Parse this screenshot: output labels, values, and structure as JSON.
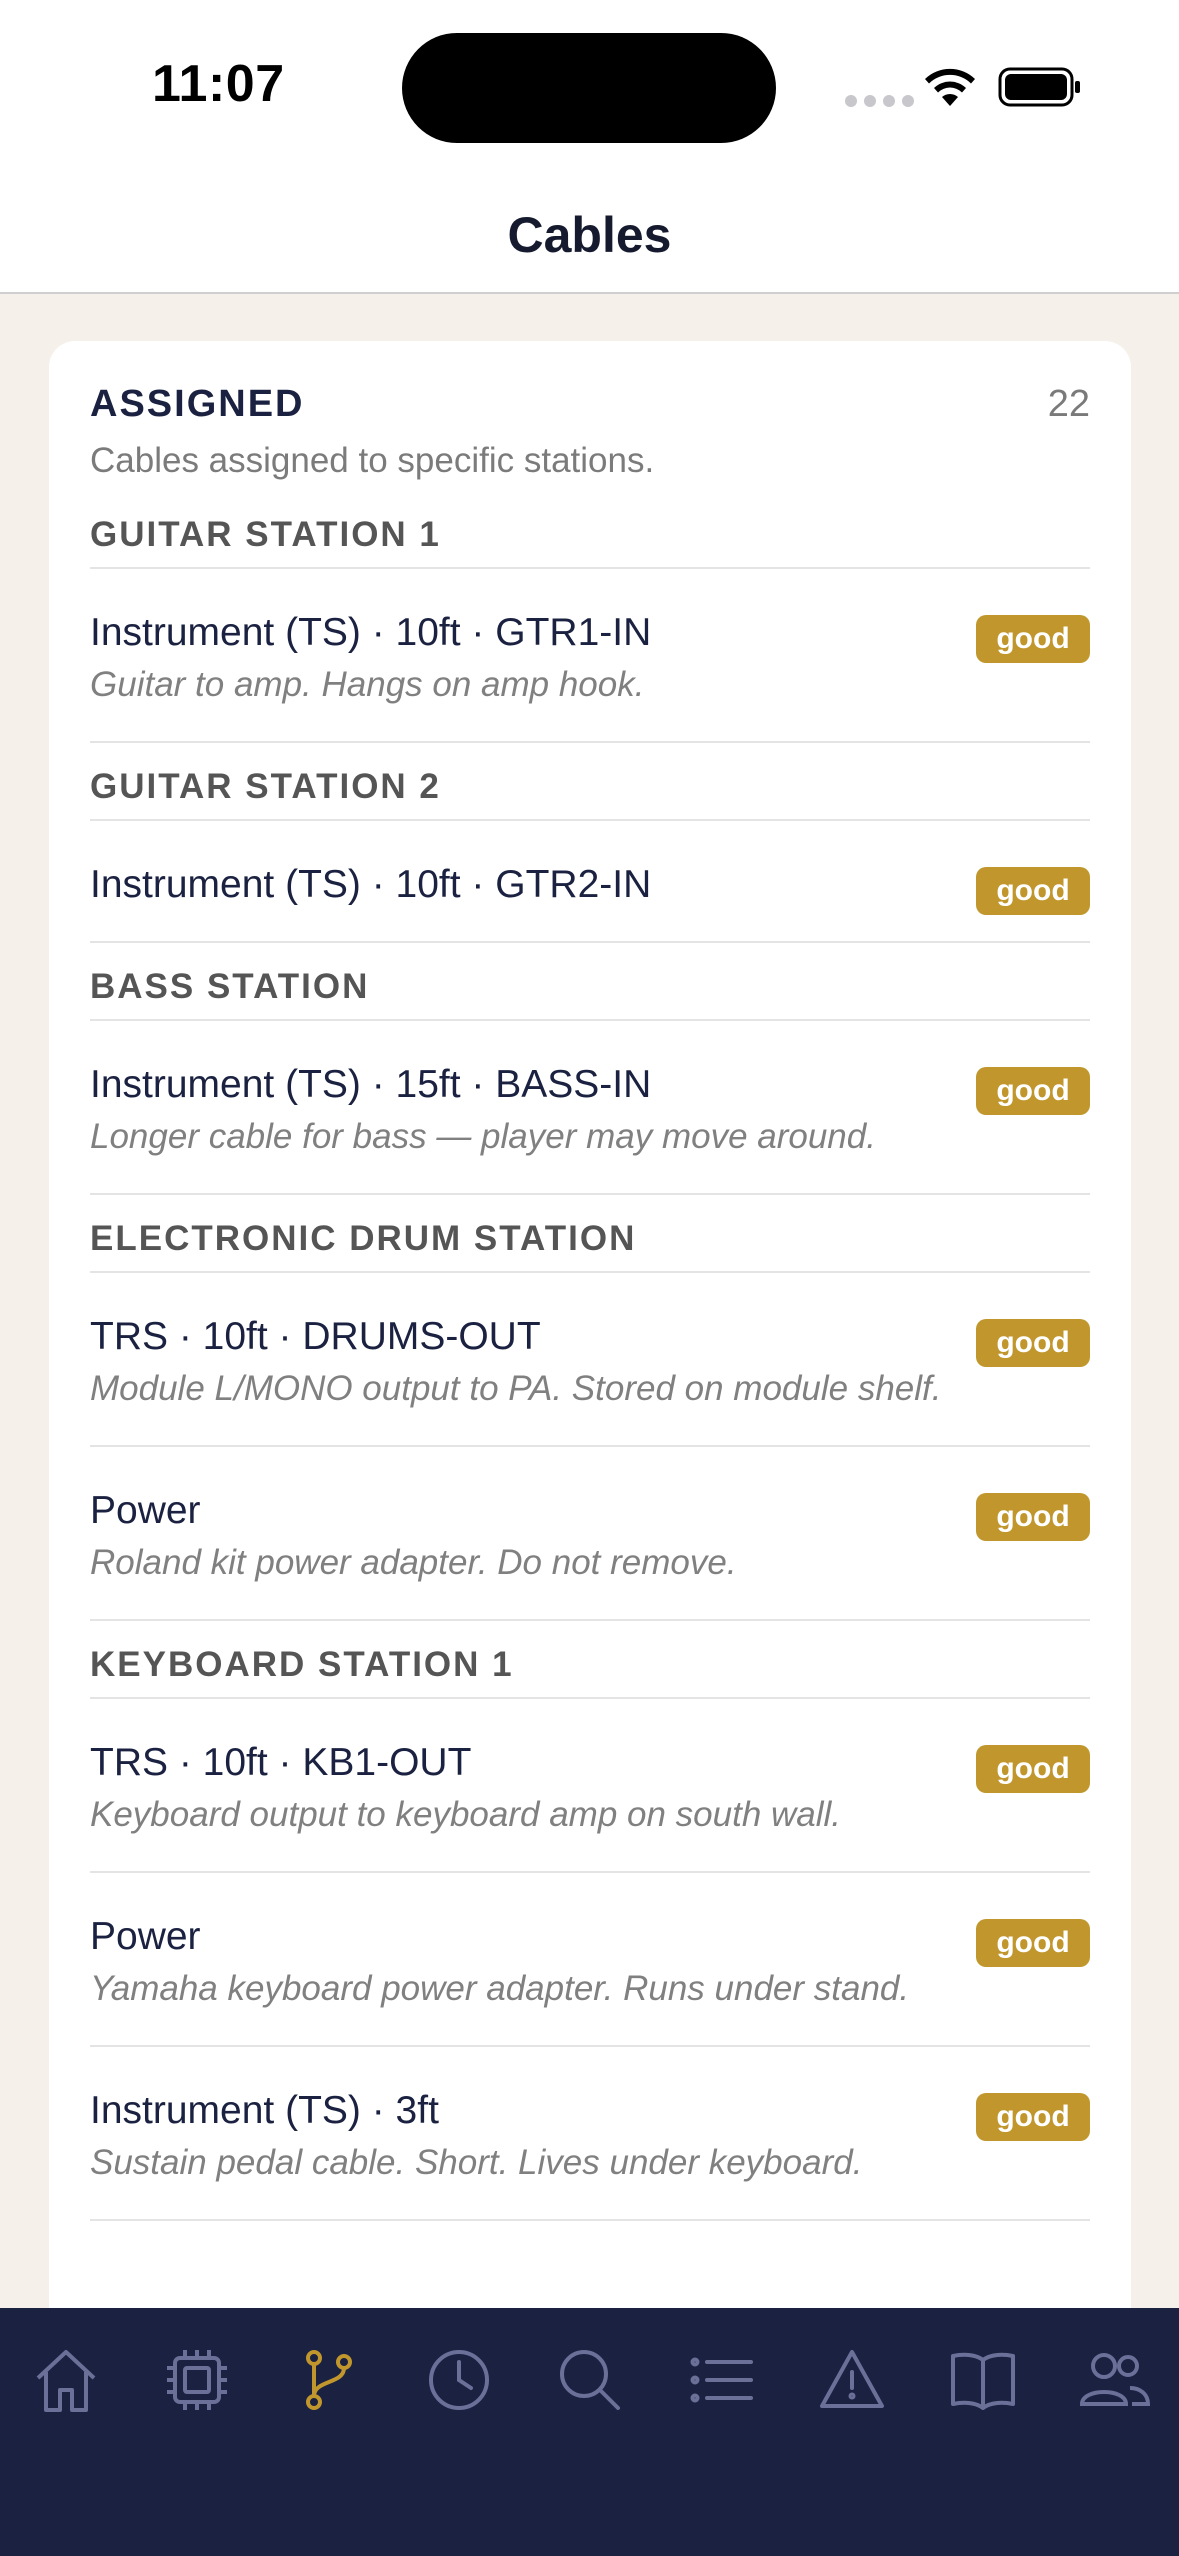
{
  "status": {
    "time": "11:07"
  },
  "nav": {
    "title": "Cables"
  },
  "section": {
    "title": "ASSIGNED",
    "count": "22",
    "description": "Cables assigned to specific stations."
  },
  "groups": [
    {
      "name": "GUITAR STATION 1",
      "items": [
        {
          "title": "Instrument (TS) · 10ft · GTR1-IN",
          "note": "Guitar to amp. Hangs on amp hook.",
          "status": "good"
        }
      ]
    },
    {
      "name": "GUITAR STATION 2",
      "items": [
        {
          "title": "Instrument (TS) · 10ft · GTR2-IN",
          "note": "",
          "status": "good"
        }
      ]
    },
    {
      "name": "BASS STATION",
      "items": [
        {
          "title": "Instrument (TS) · 15ft · BASS-IN",
          "note": "Longer cable for bass — player may move around.",
          "status": "good"
        }
      ]
    },
    {
      "name": "ELECTRONIC DRUM STATION",
      "items": [
        {
          "title": "TRS · 10ft · DRUMS-OUT",
          "note": "Module L/MONO output to PA. Stored on module shelf.",
          "status": "good"
        },
        {
          "title": "Power",
          "note": "Roland kit power adapter. Do not remove.",
          "status": "good"
        }
      ]
    },
    {
      "name": "KEYBOARD STATION 1",
      "items": [
        {
          "title": "TRS · 10ft · KB1-OUT",
          "note": "Keyboard output to keyboard amp on south wall.",
          "status": "good"
        },
        {
          "title": "Power",
          "note": "Yamaha keyboard power adapter. Runs under stand.",
          "status": "good"
        },
        {
          "title": "Instrument (TS) · 3ft",
          "note": "Sustain pedal cable. Short. Lives under keyboard.",
          "status": "good"
        }
      ]
    }
  ],
  "colors": {
    "accent": "#c1972d",
    "navy": "#1b2140",
    "icon_inactive": "#6b7099"
  },
  "tabs": [
    {
      "icon": "home-icon",
      "active": false
    },
    {
      "icon": "chip-icon",
      "active": false
    },
    {
      "icon": "branch-icon",
      "active": true
    },
    {
      "icon": "clock-icon",
      "active": false
    },
    {
      "icon": "search-icon",
      "active": false
    },
    {
      "icon": "list-icon",
      "active": false
    },
    {
      "icon": "warning-icon",
      "active": false
    },
    {
      "icon": "book-icon",
      "active": false
    },
    {
      "icon": "people-icon",
      "active": false
    }
  ]
}
